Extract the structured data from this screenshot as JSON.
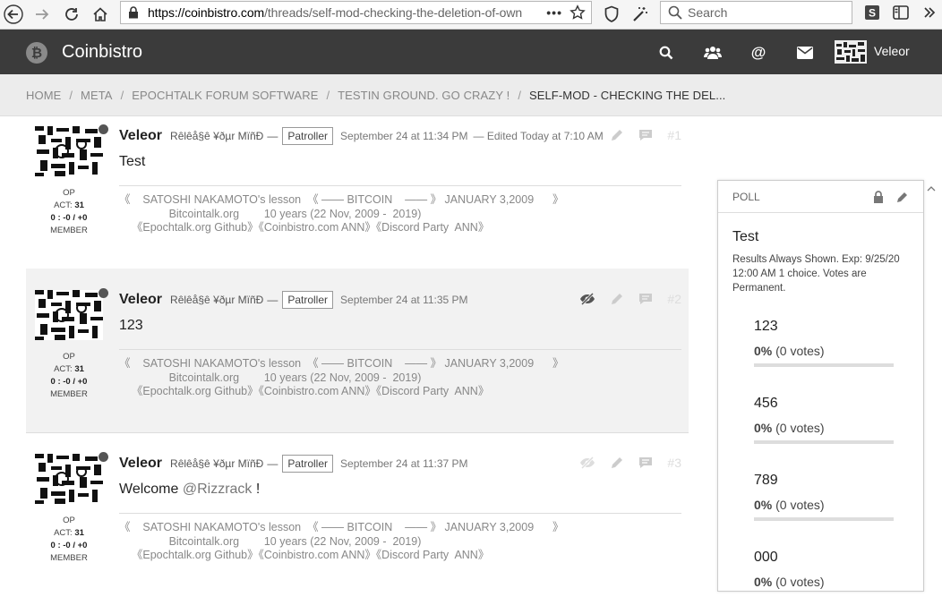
{
  "browser": {
    "url_host": "https://coinbistro.com",
    "url_path": "/threads/self-mod-checking-the-deletion-of-own",
    "search_placeholder": "Search"
  },
  "header": {
    "logo_symbol": "₿",
    "title": "Coinbistro",
    "username": "Veleor"
  },
  "breadcrumb": [
    {
      "label": "HOME"
    },
    {
      "label": "META"
    },
    {
      "label": "EPOCHTALK FORUM SOFTWARE"
    },
    {
      "label": "TESTIN GROUND. GO CRAZY !"
    },
    {
      "label": "SELF-MOD - CHECKING THE DEL..."
    }
  ],
  "posts": [
    {
      "username": "Veleor",
      "user_title": "Rêlêå§ê ¥ðµr MïñÐ",
      "role": "Patroller",
      "time": "September 24 at 11:34 PM",
      "edited": "— Edited Today at 7:10 AM",
      "num": "#1",
      "body": "Test",
      "meta_op": "OP",
      "meta_act_label": "ACT:",
      "meta_act": "31",
      "meta_merit": "0 : -0 / +0",
      "meta_rank": "MEMBER"
    },
    {
      "username": "Veleor",
      "user_title": "Rêlêå§ê ¥ðµr MïñÐ",
      "role": "Patroller",
      "time": "September 24 at 11:35 PM",
      "num": "#2",
      "body": "123",
      "meta_op": "OP",
      "meta_act_label": "ACT:",
      "meta_act": "31",
      "meta_merit": "0 : -0 / +0",
      "meta_rank": "MEMBER"
    },
    {
      "username": "Veleor",
      "user_title": "Rêlêå§ê ¥ðµr MïñÐ",
      "role": "Patroller",
      "time": "September 24 at 11:37 PM",
      "num": "#3",
      "body_prefix": "Welcome ",
      "mention": "@Rizzrack",
      "body_suffix": " !",
      "meta_op": "OP",
      "meta_act_label": "ACT:",
      "meta_act": "31",
      "meta_merit": "0 : -0 / +0",
      "meta_rank": "MEMBER"
    }
  ],
  "signature": {
    "line1": "《    SATOSHI NAKAMOTO's lesson  《 —— BITCOIN    —— 》 JANUARY 3,2009      》",
    "line2": "                Bitcointalk.org        10 years (22 Nov, 2009 -  2019)",
    "line3": "    《Epochtalk.org Github》《Coinbistro.com ANN》《Discord Party  ANN》"
  },
  "poll": {
    "label": "POLL",
    "title": "Test",
    "description": "Results Always Shown. Exp: 9/25/20 12:00 AM 1 choice. Votes are Permanent.",
    "options": [
      {
        "label": "123",
        "percent": "0%",
        "votes": " (0 votes)",
        "fraction": 0
      },
      {
        "label": "456",
        "percent": "0%",
        "votes": " (0 votes)",
        "fraction": 0
      },
      {
        "label": "789",
        "percent": "0%",
        "votes": " (0 votes)",
        "fraction": 0
      },
      {
        "label": "000",
        "percent": "0%",
        "votes": " (0 votes)",
        "fraction": 0
      }
    ]
  }
}
